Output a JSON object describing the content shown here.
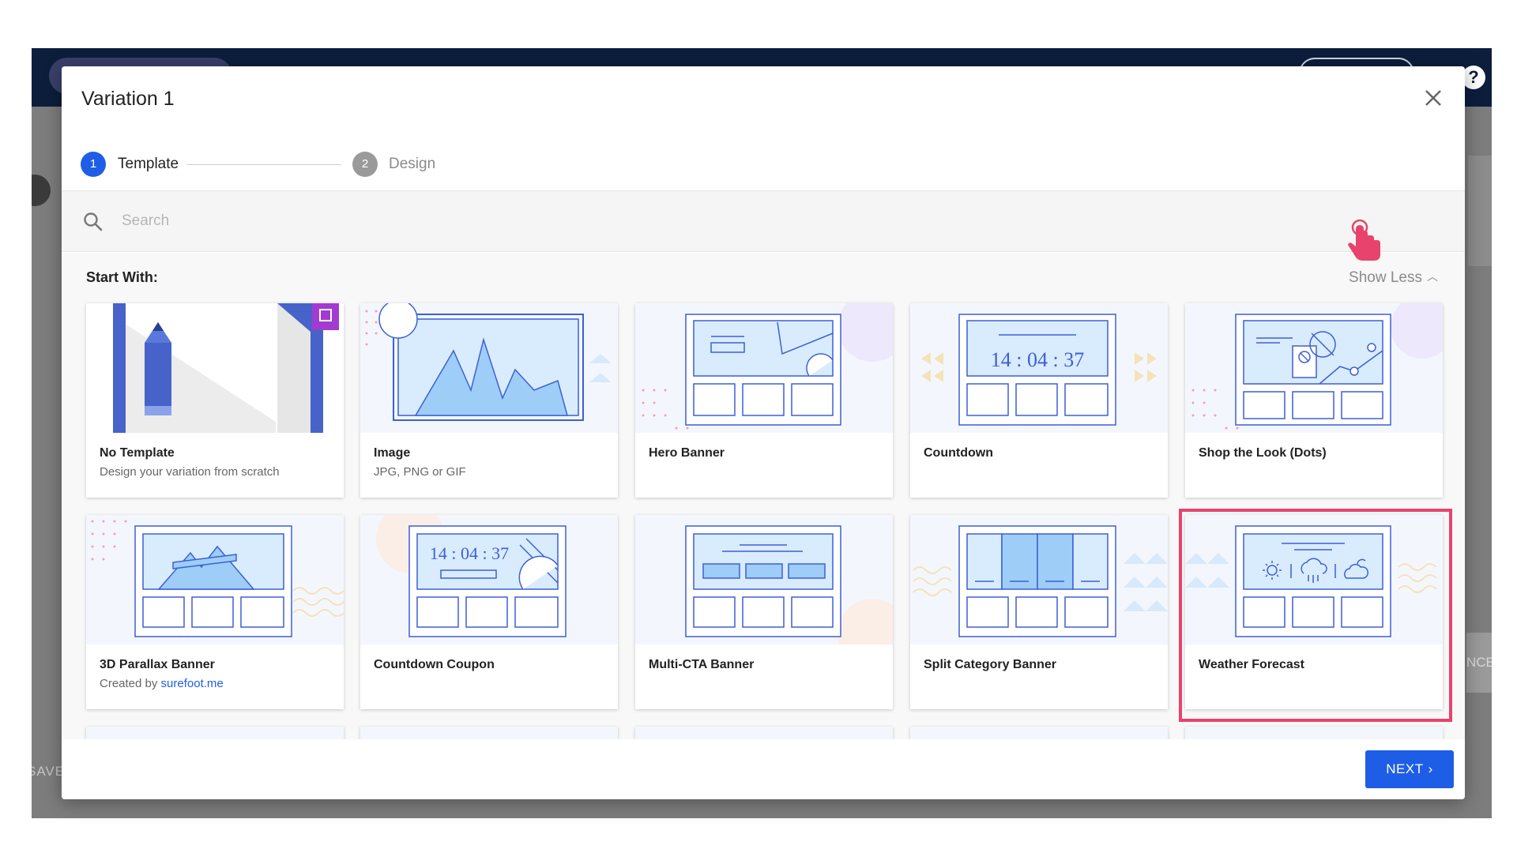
{
  "background_app": {
    "save_label": "SAVE",
    "right_button_label": "NCE",
    "help_label": "?"
  },
  "modal": {
    "title": "Variation 1",
    "steps": [
      {
        "number": "1",
        "label": "Template",
        "state": "active"
      },
      {
        "number": "2",
        "label": "Design",
        "state": "inactive"
      }
    ],
    "search": {
      "placeholder": "Search",
      "value": ""
    },
    "section_title": "Start With:",
    "toggle_label": "Show Less",
    "templates": [
      {
        "title": "No Template",
        "subtitle": "Design your variation from scratch"
      },
      {
        "title": "Image",
        "subtitle": "JPG, PNG or GIF"
      },
      {
        "title": "Hero Banner",
        "subtitle": ""
      },
      {
        "title": "Countdown",
        "subtitle": "",
        "preview_text": "14 : 04 : 37"
      },
      {
        "title": "Shop the Look (Dots)",
        "subtitle": ""
      },
      {
        "title": "3D Parallax Banner",
        "subtitle_prefix": "Created by",
        "subtitle_link": "surefoot.me"
      },
      {
        "title": "Countdown Coupon",
        "subtitle": "",
        "preview_text": "14 : 04 : 37"
      },
      {
        "title": "Multi-CTA Banner",
        "subtitle": ""
      },
      {
        "title": "Split Category Banner",
        "subtitle": ""
      },
      {
        "title": "Weather Forecast",
        "subtitle": "",
        "selected": true
      }
    ],
    "next_label": "NEXT",
    "colors": {
      "primary": "#1e5ee6",
      "highlight": "#e8436d",
      "header_dark": "#0c1e3c",
      "preview_fill": "#d9ecfd",
      "preview_stroke": "#3d5fd6"
    }
  }
}
